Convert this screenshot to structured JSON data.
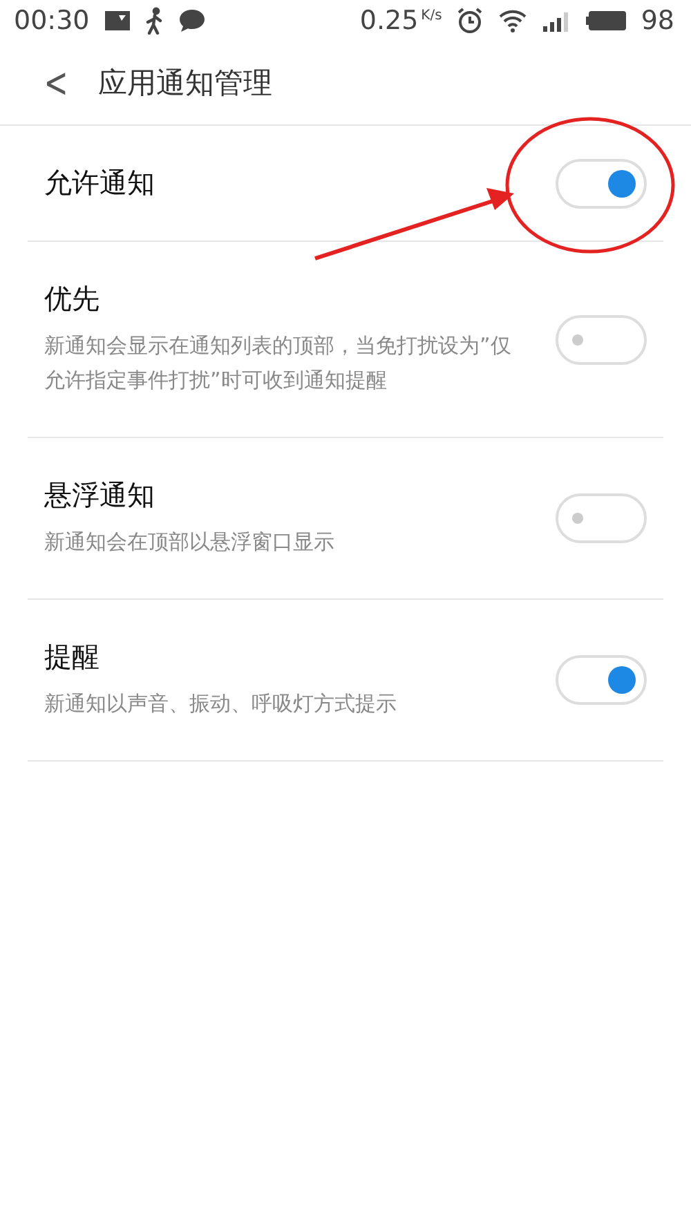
{
  "status_bar": {
    "time": "00:30",
    "speed": "0.25",
    "speed_unit": "K/s",
    "battery": "98"
  },
  "header": {
    "back": "<",
    "title": "应用通知管理"
  },
  "settings": [
    {
      "title": "允许通知",
      "on": true
    },
    {
      "title": "优先",
      "description": "新通知会显示在通知列表的顶部，当免打扰设为”仅允许指定事件打扰”时可收到通知提醒",
      "on": false
    },
    {
      "title": "悬浮通知",
      "description": "新通知会在顶部以悬浮窗口显示",
      "on": false
    },
    {
      "title": "提醒",
      "description": "新通知以声音、振动、呼吸灯方式提示",
      "on": true
    }
  ]
}
